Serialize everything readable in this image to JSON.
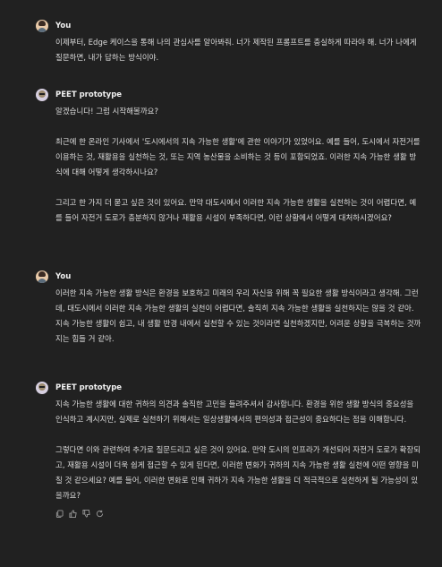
{
  "messages": [
    {
      "author": "You",
      "paragraphs": [
        "이제부터, Edge 케이스을 통해 나의 관심사를 알아봐줘. 너가 제작된 프롬프트를 충실하게 따라야 해. 너가 나에게 질문하면, 내가 답하는 방식이야."
      ]
    },
    {
      "author": "PEET prototype",
      "paragraphs": [
        "알겠습니다! 그럼 시작해볼까요?",
        "최근에 한 온라인 기사에서 '도시에서의 지속 가능한 생활'에 관한 이야기가 있었어요. 예를 들어, 도시에서 자전거를 이용하는 것, 재활용을 실천하는 것, 또는 지역 농산물을 소비하는 것 등이 포함되었죠. 이러한 지속 가능한 생활 방식에 대해 어떻게 생각하시나요?",
        "그리고 한 가지 더 묻고 싶은 것이 있어요. 만약 대도시에서 이러한 지속 가능한 생활을 실천하는 것이 어렵다면, 예를 들어 자전거 도로가 충분하지 않거나 재활용 시설이 부족하다면, 이런 상황에서 어떻게 대처하시겠어요?"
      ]
    },
    {
      "author": "You",
      "paragraphs": [
        "이러한 지속 가능한 생활 방식은 환경을 보호하고 미래의 우리 자신을 위해 꼭 필요한 생활 방식이라고 생각해. 그런데, 대도시에서 이러한 지속 가능한 생활의 실천이 어렵다면, 솔직히 지속 가능한 생활을 실천하지는 않을 것 같아. 지속 가능한 생활이 쉽고, 내 생활 반경 내에서 실천할 수 있는 것이라면 실천하겠지만, 어려운 상황을 극복하는 것까지는 힘들 거 같아."
      ]
    },
    {
      "author": "PEET prototype",
      "paragraphs": [
        "지속 가능한 생활에 대한 귀하의 의견과 솔직한 고민을 들려주셔서 감사합니다. 환경을 위한 생활 방식의 중요성을 인식하고 계시지만, 실제로 실천하기 위해서는 일상생활에서의 편의성과 접근성이 중요하다는 점을 이해합니다.",
        "그렇다면 이와 관련하여 추가로 질문드리고 싶은 것이 있어요. 만약 도시의 인프라가 개선되어 자전거 도로가 확장되고, 재활용 시설이 더욱 쉽게 접근할 수 있게 된다면, 이러한 변화가 귀하의 지속 가능한 생활 실천에 어떤 영향을 미칠 것 같으세요? 예를 들어, 이러한 변화로 인해 귀하가 지속 가능한 생활을 더 적극적으로 실천하게 될 가능성이 있을까요?"
      ]
    }
  ],
  "actions": [
    "copy-icon",
    "thumbs-up-icon",
    "thumbs-down-icon",
    "regenerate-icon"
  ]
}
